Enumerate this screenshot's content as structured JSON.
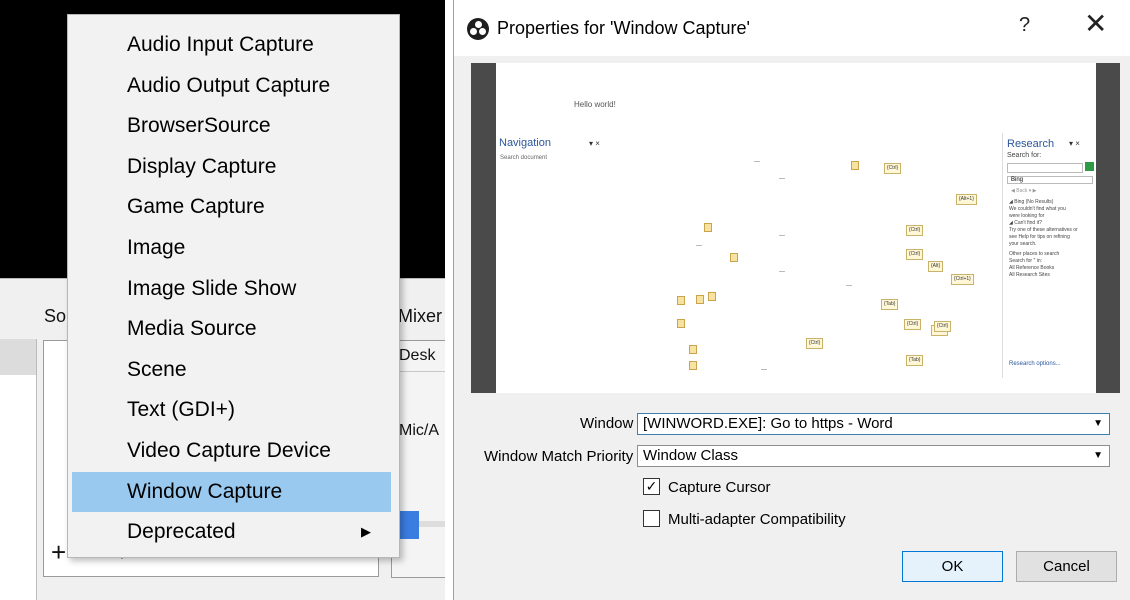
{
  "obs_main": {
    "sources_title": "So",
    "mixer_title": "Mixer",
    "mixer_channels": [
      "Desk",
      "Mic/A"
    ],
    "add_symbol": "+",
    "remove_symbol": "−",
    "settings_symbol": "⚙"
  },
  "context_menu": {
    "items": [
      {
        "label": "Audio Input Capture"
      },
      {
        "label": "Audio Output Capture"
      },
      {
        "label": "BrowserSource"
      },
      {
        "label": "Display Capture"
      },
      {
        "label": "Game Capture"
      },
      {
        "label": "Image"
      },
      {
        "label": "Image Slide Show"
      },
      {
        "label": "Media Source"
      },
      {
        "label": "Scene"
      },
      {
        "label": "Text (GDI+)"
      },
      {
        "label": "Video Capture Device"
      },
      {
        "label": "Window Capture",
        "selected": true
      },
      {
        "label": "Deprecated",
        "has_submenu": true
      }
    ],
    "submenu_arrow": "▶"
  },
  "dialog": {
    "title": "Properties for 'Window Capture'",
    "help_label": "?",
    "close_label": "✕",
    "preview": {
      "caption": "Hello world!",
      "navigation_title": "Navigation",
      "navigation_search": "Search document",
      "pane_ctrls": "▾  ×",
      "research_title": "Research",
      "research_search_for": "Search for:",
      "research_source": "Bing",
      "research_nav": "◀ Back  ▾  ▶",
      "research_lines": [
        "◢ Bing (No Results)",
        "We couldn't find what you",
        "were looking for",
        "◢ Can't find it?",
        "Try one of these alternatives or",
        "see Help for tips on refining",
        "your search.",
        "Other places to search",
        "Search for '' in:",
        "All Reference Books",
        "All Research Sites"
      ],
      "research_options": "Research options...",
      "field_codes": [
        "{Ctrl}",
        "{Alt+1}",
        "{Ctrl}",
        "{Ctrl}",
        "{Alt}",
        "{Ctrl}",
        "{Ctrl+1}",
        "{Tab}",
        "{Ctrl}",
        "{Ctrl}",
        "{Ctrl}",
        "{Tab}"
      ]
    },
    "window_label": "Window",
    "window_value": "[WINWORD.EXE]: Go to https - Word",
    "priority_label": "Window Match Priority",
    "priority_value": "Window Class",
    "capture_cursor_label": "Capture Cursor",
    "capture_cursor_checked": true,
    "multi_adapter_label": "Multi-adapter Compatibility",
    "multi_adapter_checked": false,
    "ok_label": "OK",
    "cancel_label": "Cancel",
    "checkmark": "✓",
    "combo_arrow": "▼"
  },
  "colors": {
    "menu_selection": "#99c9ef",
    "preview_frame": "#4a4a4a",
    "default_button_border": "#0078d7"
  }
}
